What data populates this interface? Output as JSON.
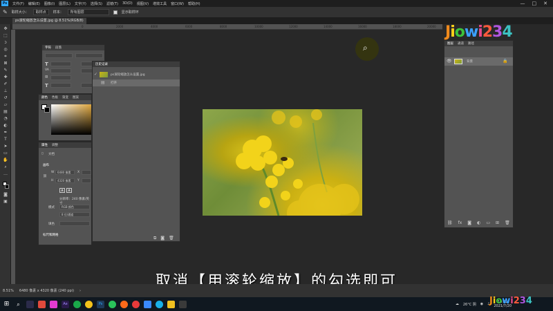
{
  "app": {
    "logo": "Ps"
  },
  "menu": [
    "文件(F)",
    "编辑(E)",
    "图像(I)",
    "图层(L)",
    "文字(Y)",
    "选择(S)",
    "滤镜(T)",
    "3D(D)",
    "视图(V)",
    "增效工具",
    "窗口(W)",
    "帮助(H)"
  ],
  "window_controls": {
    "minimize": "—",
    "maximize": "□",
    "close": "✕"
  },
  "options": {
    "sample_size_label": "取样大小：",
    "sample_size_value": "取样点",
    "sample_label": "样本：",
    "sample_value": "所有图层",
    "show_ring_label": "显示取样环"
  },
  "document_tab": "ps滚轮缩放怎么设置.jpg @ 8.51%(RGB/8)",
  "ruler_ticks": [
    "0",
    "2000",
    "4000",
    "6000",
    "8000",
    "10000",
    "12000",
    "14000",
    "16000",
    "18000",
    "20000"
  ],
  "char_panel": {
    "tabs": [
      "字符",
      "段落"
    ]
  },
  "color_panel": {
    "tabs": [
      "颜色",
      "色板",
      "渐变",
      "图案"
    ]
  },
  "history_panel": {
    "title": "历史记录",
    "items": [
      {
        "label": "ps滚轮缩放怎么设置.jpg"
      },
      {
        "label": "打开"
      }
    ]
  },
  "properties_panel": {
    "tabs": [
      "属性",
      "调整"
    ],
    "doc_label": "文档",
    "canvas_label": "画布",
    "w_label": "W",
    "w_value": "6480 像素",
    "x_label": "X",
    "h_label": "H",
    "h_value": "4320 像素",
    "y_label": "Y",
    "resolution": "分辨率：240 像素/英寸",
    "mode_label": "模式",
    "mode_value": "RGB 颜色",
    "depth_value": "8 位/通道",
    "fill_label": "填色",
    "rulers_label": "标尺和网格"
  },
  "layers_panel": {
    "tabs": [
      "图层",
      "通道",
      "路径"
    ],
    "layer_name": "背景"
  },
  "watermark": "Jiowi234",
  "caption": "取消【用滚轮缩放】的勾选即可",
  "status": {
    "zoom": "8.51%",
    "info": "6480 像素 x 4320 像素 (240 ppi)"
  },
  "tray": {
    "weather": "26°C 阴",
    "time": "13:52",
    "date": "2021/7/20"
  },
  "colors": {
    "accent": "#31a8ff",
    "panel": "#535353",
    "workspace": "#282828",
    "taskbar": "#101820"
  }
}
